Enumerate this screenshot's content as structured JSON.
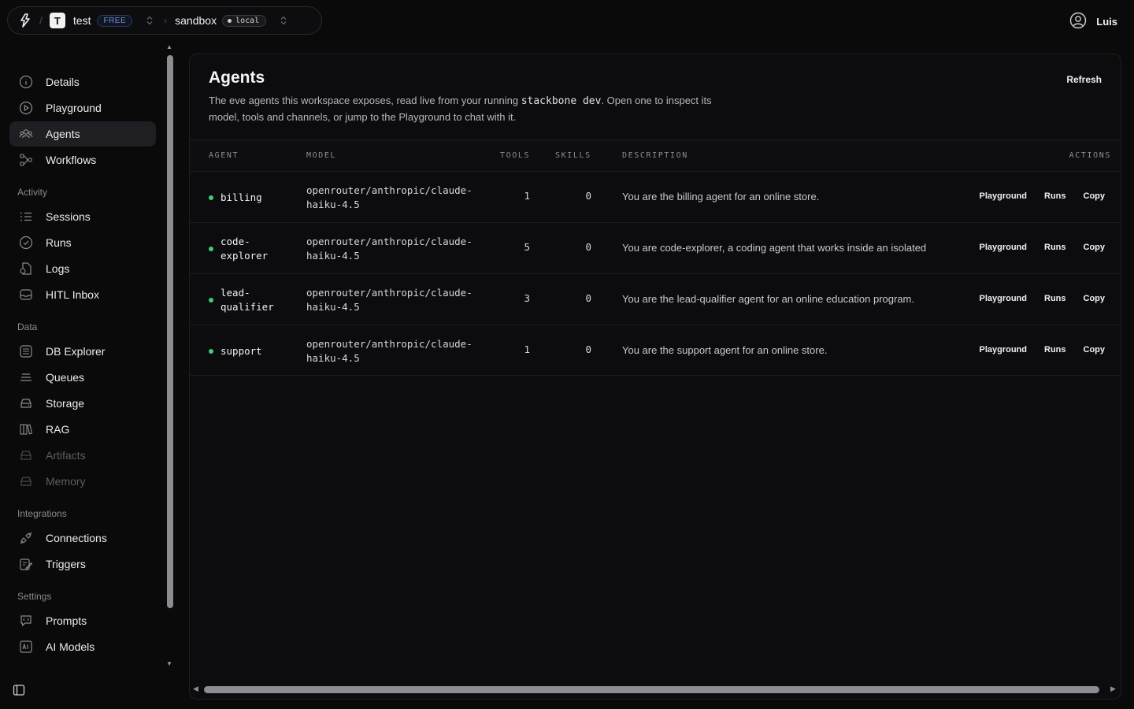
{
  "topbar": {
    "workspace_initial": "T",
    "workspace_name": "test",
    "plan_badge": "FREE",
    "environment_name": "sandbox",
    "environment_badge": "local"
  },
  "user": {
    "name": "Luis"
  },
  "sidebar": {
    "items_top": [
      {
        "label": "Details",
        "icon": "info-icon"
      },
      {
        "label": "Playground",
        "icon": "play-icon"
      },
      {
        "label": "Agents",
        "icon": "users-icon",
        "active": true
      },
      {
        "label": "Workflows",
        "icon": "workflow-icon"
      }
    ],
    "sections": [
      {
        "title": "Activity",
        "items": [
          {
            "label": "Sessions",
            "icon": "list-icon"
          },
          {
            "label": "Runs",
            "icon": "check-circle-icon"
          },
          {
            "label": "Logs",
            "icon": "logs-icon"
          },
          {
            "label": "HITL Inbox",
            "icon": "inbox-icon"
          }
        ]
      },
      {
        "title": "Data",
        "items": [
          {
            "label": "DB Explorer",
            "icon": "database-icon"
          },
          {
            "label": "Queues",
            "icon": "queue-icon"
          },
          {
            "label": "Storage",
            "icon": "storage-icon"
          },
          {
            "label": "RAG",
            "icon": "books-icon"
          },
          {
            "label": "Artifacts",
            "icon": "artifacts-icon",
            "disabled": true
          },
          {
            "label": "Memory",
            "icon": "memory-icon",
            "disabled": true
          }
        ]
      },
      {
        "title": "Integrations",
        "items": [
          {
            "label": "Connections",
            "icon": "plug-icon"
          },
          {
            "label": "Triggers",
            "icon": "trigger-icon"
          }
        ]
      },
      {
        "title": "Settings",
        "items": [
          {
            "label": "Prompts",
            "icon": "prompt-icon"
          },
          {
            "label": "AI Models",
            "icon": "ai-model-icon"
          }
        ]
      }
    ]
  },
  "page": {
    "title": "Agents",
    "description_pre": "The eve agents this workspace exposes, read live from your running ",
    "description_code": "stackbone dev",
    "description_post": ". Open one to inspect its model, tools and channels, or jump to the Playground to chat with it.",
    "refresh_label": "Refresh"
  },
  "table": {
    "headers": {
      "agent": "AGENT",
      "model": "MODEL",
      "tools": "TOOLS",
      "skills": "SKILLS",
      "description": "DESCRIPTION",
      "actions": "ACTIONS"
    },
    "action_labels": {
      "playground": "Playground",
      "runs": "Runs",
      "copy": "Copy"
    },
    "rows": [
      {
        "agent": "billing",
        "model": "openrouter/anthropic/claude-\nhaiku-4.5",
        "tools": "1",
        "skills": "0",
        "description": "You are the billing agent for an online store.",
        "status_color": "#3fcf7a"
      },
      {
        "agent": "code-\nexplorer",
        "model": "openrouter/anthropic/claude-\nhaiku-4.5",
        "tools": "5",
        "skills": "0",
        "description": "You are code-explorer, a coding agent that works inside an isolated",
        "status_color": "#3fcf7a"
      },
      {
        "agent": "lead-\nqualifier",
        "model": "openrouter/anthropic/claude-\nhaiku-4.5",
        "tools": "3",
        "skills": "0",
        "description": "You are the lead-qualifier agent for an online education program.",
        "status_color": "#3fcf7a"
      },
      {
        "agent": "support",
        "model": "openrouter/anthropic/claude-\nhaiku-4.5",
        "tools": "1",
        "skills": "0",
        "description": "You are the support agent for an online store.",
        "status_color": "#3fcf7a"
      }
    ]
  },
  "colors": {
    "background": "#0a0a0b",
    "panel": "#0c0c0e",
    "accent_status": "#3fcf7a",
    "free_badge": "#6e8fd6"
  }
}
